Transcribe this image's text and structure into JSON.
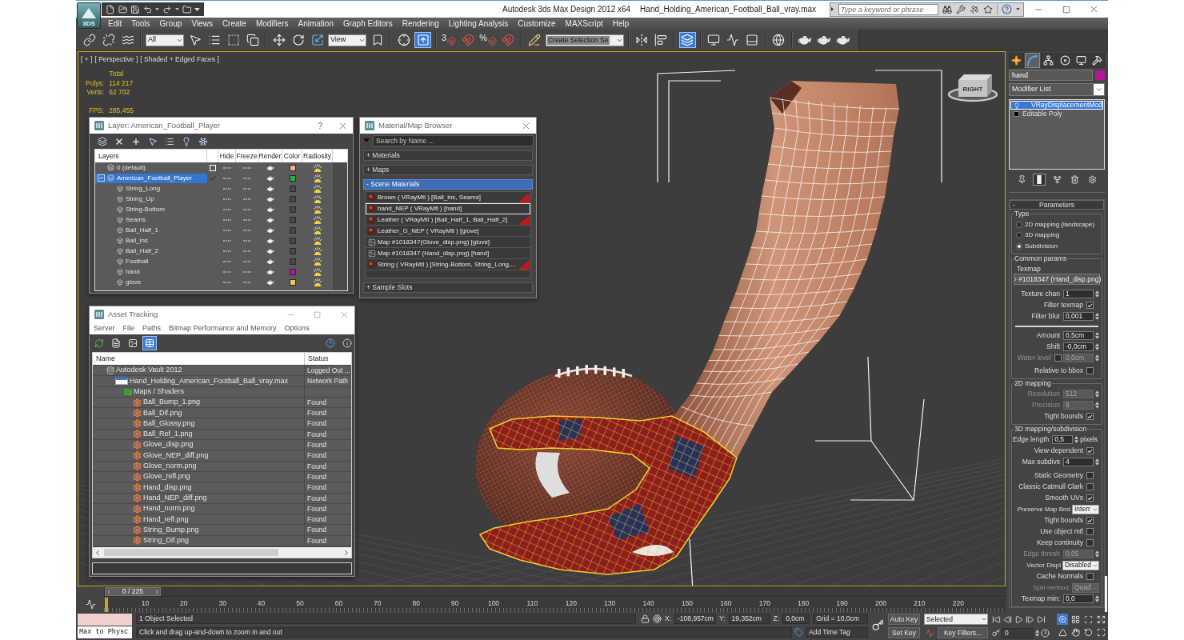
{
  "title_bar": {
    "app_badge": "3DS",
    "app_title": "Autodesk 3ds Max Design 2012 x64",
    "file_name": "Hand_Holding_American_Football_Ball_vray.max",
    "search": {
      "placeholder": "Type a keyword or phrase"
    }
  },
  "menu": [
    "Edit",
    "Tools",
    "Group",
    "Views",
    "Create",
    "Modifiers",
    "Animation",
    "Graph Editors",
    "Rendering",
    "Lighting Analysis",
    "Customize",
    "MAXScript",
    "Help"
  ],
  "main_toolbar": [
    {
      "kind": "link",
      "active": false
    },
    {
      "kind": "unlink",
      "active": false
    },
    {
      "kind": "bind",
      "active": false
    },
    {
      "kind": "separator"
    },
    {
      "kind": "filter",
      "value": "All"
    },
    {
      "kind": "select",
      "active": false
    },
    {
      "kind": "select-by-name",
      "active": false
    },
    {
      "kind": "region",
      "active": false
    },
    {
      "kind": "crossing",
      "active": false
    },
    {
      "kind": "separator"
    },
    {
      "kind": "move",
      "active": false
    },
    {
      "kind": "rotate",
      "active": false
    },
    {
      "kind": "scale",
      "active": false
    },
    {
      "kind": "filter",
      "value": "View"
    },
    {
      "kind": "pivot",
      "active": false
    },
    {
      "kind": "separator"
    },
    {
      "kind": "manipulate",
      "active": false
    },
    {
      "kind": "override",
      "active": true
    },
    {
      "kind": "separator"
    },
    {
      "kind": "snap",
      "label": "3",
      "active": false
    },
    {
      "kind": "angle-snap",
      "active": false
    },
    {
      "kind": "snap",
      "label": "%",
      "active": false
    },
    {
      "kind": "spinner-snap",
      "active": false
    },
    {
      "kind": "separator"
    },
    {
      "kind": "named-sets",
      "active": false
    },
    {
      "kind": "selection-set",
      "value": "Create Selection Se"
    },
    {
      "kind": "separator"
    },
    {
      "kind": "mirror",
      "active": false
    },
    {
      "kind": "align",
      "active": false
    },
    {
      "kind": "separator"
    },
    {
      "kind": "layers",
      "active": true
    },
    {
      "kind": "separator"
    },
    {
      "kind": "scene-explorer",
      "active": false
    },
    {
      "kind": "curve-editor",
      "active": false
    },
    {
      "kind": "schematic",
      "active": false
    },
    {
      "kind": "separator"
    },
    {
      "kind": "material-editor",
      "active": false
    },
    {
      "kind": "separator"
    },
    {
      "kind": "render-setup",
      "active": false
    },
    {
      "kind": "render-frame",
      "active": false
    },
    {
      "kind": "render",
      "active": false
    }
  ],
  "viewport": {
    "active": true,
    "label_menus": [
      "[ + ]",
      "[ Perspective ]",
      "[ Shaded + Edged Faces ]"
    ],
    "stats": {
      "heading": "Total",
      "rows": [
        {
          "label": "Polys:",
          "value": "114 217"
        },
        {
          "label": "Verts:",
          "value": "62 702"
        }
      ],
      "fps": {
        "label": "FPS:",
        "value": "285,455"
      }
    },
    "view_cube": {
      "face": "RIGHT"
    }
  },
  "layer_manager": {
    "title": "Layer: American_Football_Player",
    "help": "?",
    "columns": [
      "Layers",
      "Hide",
      "Freeze",
      "Render",
      "Color",
      "Radiosity"
    ],
    "rows": [
      {
        "name": "0 (default)",
        "kind": "layer",
        "current": false,
        "selected": false,
        "hidden": false,
        "frozen": false,
        "color": "#f2b48c"
      },
      {
        "name": "American_Football_Player",
        "kind": "layer",
        "current": true,
        "selected": true,
        "expanded": true,
        "hidden": false,
        "frozen": false,
        "color": "#22b24c",
        "children": [
          {
            "name": "String_Long",
            "kind": "object",
            "selected": false,
            "hidden": false,
            "frozen": false,
            "color": "#474747"
          },
          {
            "name": "String_Up",
            "kind": "object",
            "selected": false,
            "hidden": false,
            "frozen": false,
            "color": "#474747"
          },
          {
            "name": "String-Bottom",
            "kind": "object",
            "selected": false,
            "hidden": false,
            "frozen": false,
            "color": "#474747"
          },
          {
            "name": "Seams",
            "kind": "object",
            "selected": false,
            "hidden": false,
            "frozen": false,
            "color": "#474747"
          },
          {
            "name": "Ball_Half_1",
            "kind": "object",
            "selected": false,
            "hidden": false,
            "frozen": false,
            "color": "#474747"
          },
          {
            "name": "Ball_ins",
            "kind": "object",
            "selected": false,
            "hidden": false,
            "frozen": false,
            "color": "#474747"
          },
          {
            "name": "Ball_Half_2",
            "kind": "object",
            "selected": false,
            "hidden": false,
            "frozen": false,
            "color": "#474747"
          },
          {
            "name": "Football",
            "kind": "object",
            "selected": false,
            "hidden": false,
            "frozen": false,
            "color": "#474747"
          },
          {
            "name": "hand",
            "kind": "object",
            "selected": false,
            "hidden": false,
            "frozen": false,
            "color": "#b4169a"
          },
          {
            "name": "glove",
            "kind": "object",
            "selected": false,
            "hidden": false,
            "frozen": false,
            "color": "#f0c850"
          }
        ]
      }
    ]
  },
  "material_browser": {
    "title": "Material/Map Browser",
    "search": {
      "placeholder": "Search by Name ..."
    },
    "groups": [
      {
        "sign": "+",
        "label": "Materials",
        "expanded": false
      },
      {
        "sign": "+",
        "label": "Maps",
        "expanded": false
      },
      {
        "sign": "-",
        "label": "Scene Materials",
        "expanded": true,
        "items": [
          {
            "label": "Brown ( VRayMtl ) [Ball_ins, Seams]",
            "kind": "material",
            "selected": false,
            "flagged": true
          },
          {
            "label": "hand_NEP ( VRayMtl ) [hand]",
            "kind": "material",
            "selected": true,
            "flagged": false
          },
          {
            "label": "Leather ( VRayMtl ) [Ball_Half_1, Ball_Half_2]",
            "kind": "material",
            "selected": false,
            "flagged": true
          },
          {
            "label": "Leather_G_NEP ( VRayMtl ) [glove]",
            "kind": "material",
            "selected": false,
            "flagged": false
          },
          {
            "label": "Map #1018347(Glove_disp.png) [glove]",
            "kind": "map",
            "selected": false,
            "flagged": false
          },
          {
            "label": "Map #1018347 (Hand_disp.png) [hand]",
            "kind": "map",
            "selected": false,
            "flagged": false
          },
          {
            "label": "String ( VRayMtl ) [String-Bottom, String_Long,...",
            "kind": "material",
            "selected": false,
            "flagged": true
          }
        ]
      },
      {
        "sign": "+",
        "label": "Sample Slots",
        "expanded": false
      }
    ]
  },
  "asset_tracking": {
    "title": "Asset Tracking",
    "menu": [
      "Server",
      "File",
      "Paths",
      "Bitmap Performance and Memory",
      "Options"
    ],
    "toolbar": [
      {
        "kind": "refresh",
        "active": false
      },
      {
        "kind": "list",
        "active": false
      },
      {
        "kind": "thumbnails",
        "active": false
      },
      {
        "kind": "table",
        "active": true
      }
    ],
    "columns": [
      "Name",
      "Status"
    ],
    "rows": [
      {
        "name": "Autodesk Vault 2012",
        "status": "Logged Out ...",
        "kind": "vault",
        "children": [
          {
            "name": "Hand_Holding_American_Football_Ball_vray.max",
            "status": "Network Path",
            "kind": "scene",
            "children": [
              {
                "name": "Maps / Shaders",
                "kind": "folder",
                "children": [
                  {
                    "name": "Ball_Bump_1.png",
                    "status": "Found",
                    "kind": "bitmap"
                  },
                  {
                    "name": "Ball_Dif.png",
                    "status": "Found",
                    "kind": "bitmap"
                  },
                  {
                    "name": "Ball_Glossy.png",
                    "status": "Found",
                    "kind": "bitmap"
                  },
                  {
                    "name": "Ball_Ref_1.png",
                    "status": "Found",
                    "kind": "bitmap"
                  },
                  {
                    "name": "Glove_disp.png",
                    "status": "Found",
                    "kind": "bitmap"
                  },
                  {
                    "name": "Glove_NEP_diff.png",
                    "status": "Found",
                    "kind": "bitmap"
                  },
                  {
                    "name": "Glove_norm.png",
                    "status": "Found",
                    "kind": "bitmap"
                  },
                  {
                    "name": "Glove_refl.png",
                    "status": "Found",
                    "kind": "bitmap"
                  },
                  {
                    "name": "Hand_disp.png",
                    "status": "Found",
                    "kind": "bitmap"
                  },
                  {
                    "name": "Hand_NEP_diff.png",
                    "status": "Found",
                    "kind": "bitmap"
                  },
                  {
                    "name": "Hand_norm.png",
                    "status": "Found",
                    "kind": "bitmap"
                  },
                  {
                    "name": "Hand_refl.png",
                    "status": "Found",
                    "kind": "bitmap"
                  },
                  {
                    "name": "String_Bump.png",
                    "status": "Found",
                    "kind": "bitmap"
                  },
                  {
                    "name": "String_Dif.png",
                    "status": "Found",
                    "kind": "bitmap"
                  }
                ]
              }
            ]
          }
        ]
      }
    ]
  },
  "command_panel": {
    "tabs": [
      {
        "kind": "create",
        "selected": false
      },
      {
        "kind": "modify",
        "selected": true
      },
      {
        "kind": "hierarchy",
        "selected": false
      },
      {
        "kind": "motion",
        "selected": false
      },
      {
        "kind": "display",
        "selected": false
      },
      {
        "kind": "utilities",
        "selected": false
      }
    ],
    "object": {
      "name": "hand",
      "color": "#b4169a"
    },
    "modifier_list": "Modifier List",
    "stack": [
      {
        "label": "VRayDisplacementMod",
        "kind": "modifier",
        "selected": true
      },
      {
        "label": "Editable Poly",
        "kind": "base",
        "selected": false
      }
    ],
    "stack_buttons": [
      {
        "kind": "pin",
        "active": false
      },
      {
        "kind": "end-result",
        "active": true
      },
      {
        "kind": "make-unique",
        "active": false
      },
      {
        "kind": "remove",
        "active": false
      },
      {
        "kind": "configure",
        "active": false
      }
    ],
    "rollout": {
      "sign": "-",
      "title": "Parameters",
      "expanded": true,
      "groups": [
        {
          "title": "Type",
          "rows": [
            {
              "kind": "radio",
              "label": "2D mapping (landscape)",
              "selected": false
            },
            {
              "kind": "radio",
              "label": "3D mapping",
              "selected": false
            },
            {
              "kind": "radio",
              "label": "Subdivision",
              "selected": true
            }
          ]
        },
        {
          "title": "Common params",
          "rows": [
            {
              "kind": "caption",
              "label": "Texmap"
            },
            {
              "kind": "map-button",
              "value": "› #1018347 (Hand_disp.png)"
            },
            {
              "kind": "spinner",
              "label": "Texture chan",
              "value": "1",
              "disabled": false
            },
            {
              "kind": "checkbox",
              "label": "Filter texmap",
              "checked": true
            },
            {
              "kind": "spinner",
              "label": "Filter blur",
              "value": "0,001",
              "disabled": false
            },
            {
              "kind": "rule"
            },
            {
              "kind": "spinner",
              "label": "Amount",
              "value": "0,5cm",
              "disabled": false
            },
            {
              "kind": "spinner",
              "label": "Shift",
              "value": "-0,0cm",
              "disabled": false
            },
            {
              "kind": "check-spinner",
              "label": "Water level",
              "checked": false,
              "value": "0,0cm",
              "disabled": true
            },
            {
              "kind": "checkbox",
              "label": "Relative to bbox",
              "checked": false
            }
          ]
        },
        {
          "title": "2D mapping",
          "rows": [
            {
              "kind": "spinner",
              "label": "Resolution",
              "value": "512",
              "disabled": true
            },
            {
              "kind": "spinner",
              "label": "Precision",
              "value": "8",
              "disabled": true
            },
            {
              "kind": "checkbox",
              "label": "Tight bounds",
              "checked": true
            }
          ]
        },
        {
          "title": "3D mapping/subdivision",
          "rows": [
            {
              "kind": "spinner",
              "label": "Edge length",
              "value": "0,5",
              "unit": "pixels",
              "disabled": false
            },
            {
              "kind": "checkbox",
              "label": "View-dependent",
              "checked": true
            },
            {
              "kind": "spinner",
              "label": "Max subdivs",
              "value": "4",
              "disabled": false
            },
            {
              "kind": "checkbox",
              "label": "Static Geometry",
              "checked": false
            },
            {
              "kind": "checkbox",
              "label": "Classic Catmull Clark",
              "checked": false
            },
            {
              "kind": "checkbox",
              "label": "Smooth UVs",
              "checked": true
            },
            {
              "kind": "dropdown",
              "label": "Preserve Map Bnd",
              "value": "Interr",
              "disabled": false
            },
            {
              "kind": "checkbox",
              "label": "Tight bounds",
              "checked": true
            },
            {
              "kind": "checkbox",
              "label": "Use object mtl",
              "checked": false
            },
            {
              "kind": "checkbox",
              "label": "Keep continuity",
              "checked": false
            },
            {
              "kind": "spinner",
              "label": "Edge thresh",
              "value": "0,05",
              "disabled": true
            },
            {
              "kind": "dropdown",
              "label": "Vector Displ",
              "value": "Disabled",
              "disabled": false
            },
            {
              "kind": "checkbox",
              "label": "Cache Normals",
              "checked": false
            },
            {
              "kind": "dropdown",
              "label": "Split method:",
              "value": "Quad",
              "disabled": true
            },
            {
              "kind": "spinner",
              "label": "Texmap min:",
              "value": "0,0",
              "disabled": false
            }
          ]
        }
      ]
    }
  },
  "time_slider": {
    "label": "0 / 225",
    "level": 0,
    "ticks": [
      "10",
      "20",
      "30",
      "40",
      "50",
      "60",
      "70",
      "80",
      "90",
      "100",
      "110",
      "120",
      "130",
      "140",
      "150",
      "160",
      "170",
      "180",
      "190",
      "200",
      "210",
      "220"
    ]
  },
  "status_bar": {
    "listener_input": "Max to Physc",
    "selection": "1 Object Selected",
    "prompt": "Click and drag up-and-down to zoom in and out",
    "coords": [
      {
        "axis": "X:",
        "value": "-108,957cm"
      },
      {
        "axis": "Y:",
        "value": "19,352cm"
      },
      {
        "axis": "Z:",
        "value": "0,0cm"
      }
    ],
    "grid": "Grid = 10,0cm",
    "time_tag": "Add Time Tag",
    "auto_key": {
      "label": "Auto Key",
      "on": false
    },
    "key_set": "Selected",
    "set_key": "Set Key",
    "key_filters": "Key Filters...",
    "frame": "0",
    "nav_tools": [
      {
        "kind": "zoom",
        "active": true
      },
      {
        "kind": "zoom-all",
        "active": false
      },
      {
        "kind": "zoom-extents",
        "active": false
      },
      {
        "kind": "zoom-extents-all",
        "active": false
      },
      {
        "kind": "field-of-view",
        "active": false
      },
      {
        "kind": "pan",
        "active": false
      },
      {
        "kind": "orbit",
        "active": false
      },
      {
        "kind": "maximize",
        "active": false
      }
    ]
  }
}
